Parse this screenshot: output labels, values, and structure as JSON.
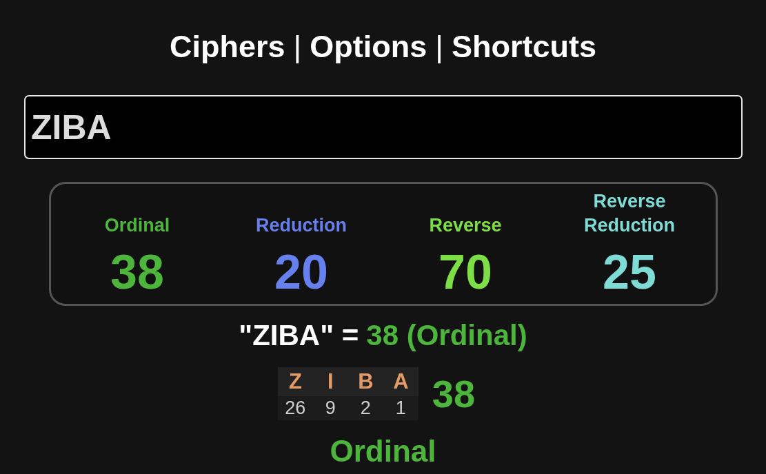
{
  "nav": [
    {
      "kind": "link",
      "label": "Ciphers"
    },
    {
      "kind": "separator",
      "label": "|"
    },
    {
      "kind": "link",
      "label": "Options"
    },
    {
      "kind": "separator",
      "label": "|"
    },
    {
      "kind": "link",
      "label": "Shortcuts"
    }
  ],
  "input": {
    "value": "ZIBA"
  },
  "ciphers": [
    {
      "name": "Ordinal",
      "value": "38",
      "color": "#4db53c"
    },
    {
      "name": "Reduction",
      "value": "20",
      "color": "#6680ee"
    },
    {
      "name": "Reverse",
      "value": "70",
      "color": "#7ddf45"
    },
    {
      "name": "Reverse Reduction",
      "value": "25",
      "color": "#7fdbd6"
    }
  ],
  "result": {
    "phrase": "\"ZIBA\" =",
    "value": "38 (Ordinal)"
  },
  "breakdown": {
    "letters": [
      {
        "letter": "Z",
        "value": "26"
      },
      {
        "letter": "I",
        "value": "9"
      },
      {
        "letter": "B",
        "value": "2"
      },
      {
        "letter": "A",
        "value": "1"
      }
    ],
    "total": "38",
    "cipher": "Ordinal"
  }
}
